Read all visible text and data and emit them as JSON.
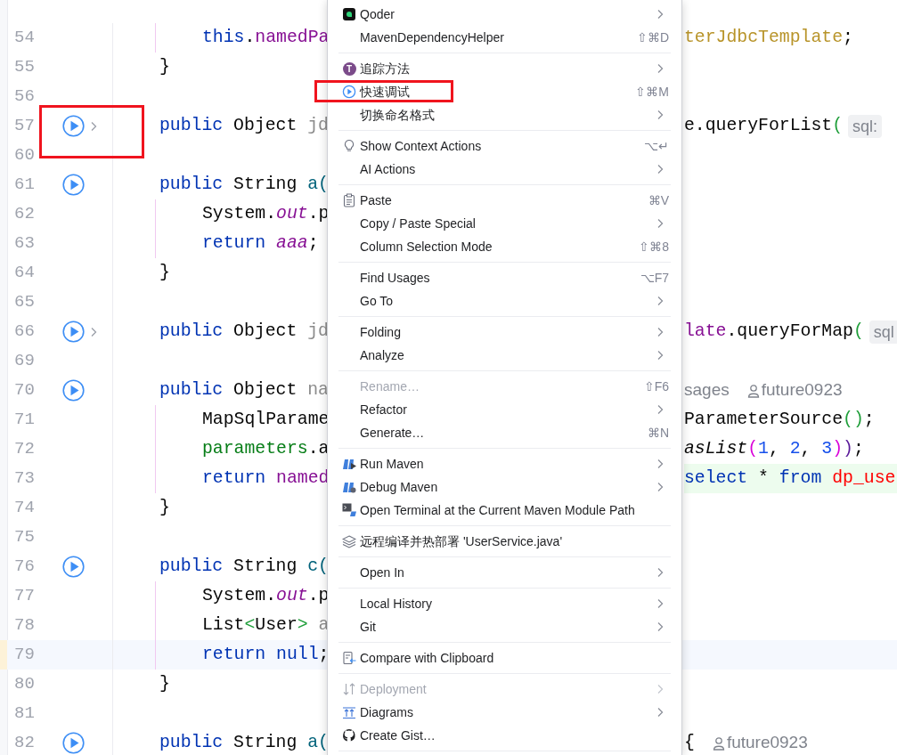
{
  "editor": {
    "annotated": true,
    "lines": [
      {
        "number": "54",
        "indented": true,
        "current": false,
        "left": [
          {
            "text": "this",
            "kind": "keyword"
          },
          {
            "text": ".",
            "kind": "plain"
          },
          {
            "text": "namedPa",
            "kind": "field"
          }
        ],
        "right": [
          {
            "kind": "code",
            "injected": false,
            "tokens": [
              {
                "text": "terJdbcTemplate",
                "kind": "type"
              },
              {
                "text": ";",
                "kind": "plain"
              }
            ]
          }
        ]
      },
      {
        "number": "55",
        "indented": false,
        "current": false,
        "left": [
          {
            "text": "}",
            "kind": "plain"
          }
        ]
      },
      {
        "number": "56",
        "indented": false,
        "current": false
      },
      {
        "number": "57",
        "indented": false,
        "run_marker": {
          "expandable": true
        },
        "current": false,
        "left": [
          {
            "text": "public",
            "kind": "keyword"
          },
          {
            "text": " Object",
            "kind": "plain"
          },
          {
            "text": " jd",
            "kind": "unused"
          }
        ],
        "right": [
          {
            "kind": "code",
            "injected": false,
            "tokens": [
              {
                "text": "e.queryForList",
                "kind": "plain"
              },
              {
                "text": "(",
                "kind": "paren-green"
              }
            ]
          },
          {
            "kind": "hint",
            "text": "sql:"
          }
        ]
      },
      {
        "number": "60",
        "indented": false,
        "current": false
      },
      {
        "number": "61",
        "indented": false,
        "run_marker": {
          "expandable": false
        },
        "current": false,
        "left": [
          {
            "text": "public",
            "kind": "keyword"
          },
          {
            "text": " String",
            "kind": "plain"
          },
          {
            "text": " a(",
            "kind": "method"
          }
        ]
      },
      {
        "number": "62",
        "indented": true,
        "current": false,
        "left": [
          {
            "text": "System.",
            "kind": "plain"
          },
          {
            "text": "out",
            "kind": "static"
          },
          {
            "text": ".p",
            "kind": "plain"
          }
        ]
      },
      {
        "number": "63",
        "indented": true,
        "current": false,
        "left": [
          {
            "text": "return",
            "kind": "keyword"
          },
          {
            "text": " aaa",
            "kind": "static"
          },
          {
            "text": ";",
            "kind": "plain"
          }
        ]
      },
      {
        "number": "64",
        "indented": false,
        "current": false,
        "left": [
          {
            "text": "}",
            "kind": "plain"
          }
        ]
      },
      {
        "number": "65",
        "indented": false,
        "current": false
      },
      {
        "number": "66",
        "indented": false,
        "run_marker": {
          "expandable": true
        },
        "current": false,
        "left": [
          {
            "text": "public",
            "kind": "keyword"
          },
          {
            "text": " Object",
            "kind": "plain"
          },
          {
            "text": " jd",
            "kind": "unused"
          }
        ],
        "right": [
          {
            "kind": "code",
            "injected": false,
            "tokens": [
              {
                "text": "late",
                "kind": "field"
              },
              {
                "text": ".queryForMap",
                "kind": "plain"
              },
              {
                "text": "(",
                "kind": "paren-green"
              }
            ]
          },
          {
            "kind": "hint",
            "text": "sql"
          }
        ]
      },
      {
        "number": "69",
        "indented": false,
        "current": false
      },
      {
        "number": "70",
        "indented": false,
        "run_marker": {
          "expandable": false
        },
        "current": false,
        "left": [
          {
            "text": "public",
            "kind": "keyword"
          },
          {
            "text": " Object",
            "kind": "plain"
          },
          {
            "text": " na",
            "kind": "unused"
          }
        ],
        "right": [
          {
            "kind": "usages",
            "text": "sages"
          },
          {
            "kind": "author",
            "text": "future0923"
          }
        ]
      },
      {
        "number": "71",
        "indented": true,
        "current": false,
        "left": [
          {
            "text": "MapSqlParame",
            "kind": "plain"
          }
        ],
        "right": [
          {
            "kind": "code",
            "injected": false,
            "tokens": [
              {
                "text": "ParameterSource",
                "kind": "plain"
              },
              {
                "text": "()",
                "kind": "paren-green"
              },
              {
                "text": ";",
                "kind": "plain"
              }
            ]
          }
        ]
      },
      {
        "number": "72",
        "indented": true,
        "current": false,
        "left": [
          {
            "text": "parameters",
            "kind": "local"
          },
          {
            "text": ".a",
            "kind": "plain"
          }
        ],
        "right": [
          {
            "kind": "code",
            "injected": false,
            "tokens": [
              {
                "text": "asList",
                "kind": "italic"
              },
              {
                "text": "(",
                "kind": "paren-magenta"
              },
              {
                "text": "1",
                "kind": "number"
              },
              {
                "text": ",",
                "kind": "plain"
              },
              {
                "text": " 2",
                "kind": "number"
              },
              {
                "text": ",",
                "kind": "plain"
              },
              {
                "text": " 3",
                "kind": "number"
              },
              {
                "text": ")",
                "kind": "paren-magenta"
              },
              {
                "text": ")",
                "kind": "paren-purple"
              },
              {
                "text": ";",
                "kind": "plain"
              }
            ]
          }
        ]
      },
      {
        "number": "73",
        "indented": true,
        "current": false,
        "left": [
          {
            "text": "return",
            "kind": "keyword"
          },
          {
            "text": " named",
            "kind": "field"
          }
        ],
        "right": [
          {
            "kind": "code",
            "injected": true,
            "tokens": [
              {
                "text": "select",
                "kind": "keyword"
              },
              {
                "text": " *",
                "kind": "plain"
              },
              {
                "text": " from",
                "kind": "keyword"
              },
              {
                "text": " dp_use",
                "kind": "table"
              }
            ]
          }
        ]
      },
      {
        "number": "74",
        "indented": false,
        "current": false,
        "left": [
          {
            "text": "}",
            "kind": "plain"
          }
        ]
      },
      {
        "number": "75",
        "indented": false,
        "current": false
      },
      {
        "number": "76",
        "indented": false,
        "run_marker": {
          "expandable": false
        },
        "current": false,
        "left": [
          {
            "text": "public",
            "kind": "keyword"
          },
          {
            "text": " String",
            "kind": "plain"
          },
          {
            "text": " c(",
            "kind": "method"
          }
        ]
      },
      {
        "number": "77",
        "indented": true,
        "current": false,
        "left": [
          {
            "text": "System.",
            "kind": "plain"
          },
          {
            "text": "out",
            "kind": "static"
          },
          {
            "text": ".p",
            "kind": "plain"
          }
        ]
      },
      {
        "number": "78",
        "indented": true,
        "current": false,
        "left": [
          {
            "text": "List",
            "kind": "plain"
          },
          {
            "text": "<",
            "kind": "paren-green"
          },
          {
            "text": "User",
            "kind": "plain"
          },
          {
            "text": ">",
            "kind": "paren-green"
          },
          {
            "text": " a",
            "kind": "unused"
          }
        ]
      },
      {
        "number": "79",
        "indented": true,
        "current": true,
        "left": [
          {
            "text": "return",
            "kind": "keyword"
          },
          {
            "text": " null",
            "kind": "keyword"
          },
          {
            "text": ";",
            "kind": "plain"
          }
        ]
      },
      {
        "number": "80",
        "indented": false,
        "current": false,
        "left": [
          {
            "text": "}",
            "kind": "plain"
          }
        ]
      },
      {
        "number": "81",
        "indented": false,
        "current": false
      },
      {
        "number": "82",
        "indented": false,
        "run_marker": {
          "expandable": false
        },
        "current": false,
        "left": [
          {
            "text": "public",
            "kind": "keyword"
          },
          {
            "text": " String",
            "kind": "plain"
          },
          {
            "text": " a(",
            "kind": "method"
          }
        ],
        "right": [
          {
            "kind": "code",
            "injected": false,
            "tokens": [
              {
                "text": "{",
                "kind": "plain"
              }
            ]
          },
          {
            "kind": "author",
            "text": "future0923"
          }
        ]
      }
    ]
  },
  "context_menu": {
    "annotated": true,
    "groups": [
      {
        "items": [
          {
            "label": "Qoder",
            "kind": "plugin",
            "submenu": true,
            "disabled": false
          },
          {
            "label": "MavenDependencyHelper",
            "kind": "plain",
            "shortcut": "⇧⌘D",
            "submenu": false,
            "disabled": false
          }
        ]
      },
      {
        "items": [
          {
            "label": "追踪方法",
            "kind": "letter",
            "badge": "T",
            "submenu": true,
            "disabled": false
          },
          {
            "label": "快速调试",
            "kind": "run",
            "shortcut": "⇧⌘M",
            "submenu": false,
            "disabled": false
          },
          {
            "label": "切换命名格式",
            "kind": "plain",
            "submenu": true,
            "disabled": false
          }
        ]
      },
      {
        "items": [
          {
            "label": "Show Context Actions",
            "kind": "bulb",
            "shortcut": "⌥↵",
            "submenu": false,
            "disabled": false
          },
          {
            "label": "AI Actions",
            "kind": "plain",
            "submenu": true,
            "disabled": false
          }
        ]
      },
      {
        "items": [
          {
            "label": "Paste",
            "kind": "clipboard",
            "shortcut": "⌘V",
            "submenu": false,
            "disabled": false
          },
          {
            "label": "Copy / Paste Special",
            "kind": "plain",
            "submenu": true,
            "disabled": false
          },
          {
            "label": "Column Selection Mode",
            "kind": "plain",
            "shortcut": "⇧⌘8",
            "submenu": false,
            "disabled": false
          }
        ]
      },
      {
        "items": [
          {
            "label": "Find Usages",
            "kind": "plain",
            "shortcut": "⌥F7",
            "submenu": false,
            "disabled": false
          },
          {
            "label": "Go To",
            "kind": "plain",
            "submenu": true,
            "disabled": false
          }
        ]
      },
      {
        "items": [
          {
            "label": "Folding",
            "kind": "plain",
            "submenu": true,
            "disabled": false
          },
          {
            "label": "Analyze",
            "kind": "plain",
            "submenu": true,
            "disabled": false
          }
        ]
      },
      {
        "items": [
          {
            "label": "Rename…",
            "kind": "plain",
            "shortcut": "⇧F6",
            "submenu": false,
            "disabled": true
          },
          {
            "label": "Refactor",
            "kind": "plain",
            "submenu": true,
            "disabled": false
          },
          {
            "label": "Generate…",
            "kind": "plain",
            "shortcut": "⌘N",
            "submenu": false,
            "disabled": false
          }
        ]
      },
      {
        "items": [
          {
            "label": "Run Maven",
            "kind": "maven-run",
            "submenu": true,
            "disabled": false
          },
          {
            "label": "Debug Maven",
            "kind": "maven-debug",
            "submenu": true,
            "disabled": false
          },
          {
            "label": "Open Terminal at the Current Maven Module Path",
            "kind": "terminal",
            "submenu": false,
            "disabled": false
          }
        ]
      },
      {
        "items": [
          {
            "label": "远程编译并热部署 'UserService.java'",
            "kind": "layers",
            "submenu": false,
            "disabled": false
          }
        ]
      },
      {
        "items": [
          {
            "label": "Open In",
            "kind": "plain",
            "submenu": true,
            "disabled": false
          }
        ]
      },
      {
        "items": [
          {
            "label": "Local History",
            "kind": "plain",
            "submenu": true,
            "disabled": false
          },
          {
            "label": "Git",
            "kind": "plain",
            "submenu": true,
            "disabled": false
          }
        ]
      },
      {
        "items": [
          {
            "label": "Compare with Clipboard",
            "kind": "compare",
            "submenu": false,
            "disabled": false
          }
        ]
      },
      {
        "items": [
          {
            "label": "Deployment",
            "kind": "transfer",
            "submenu": true,
            "disabled": true
          },
          {
            "label": "Diagrams",
            "kind": "diagram",
            "submenu": true,
            "disabled": false
          },
          {
            "label": "Create Gist…",
            "kind": "gist",
            "submenu": false,
            "disabled": false
          }
        ]
      }
    ]
  }
}
